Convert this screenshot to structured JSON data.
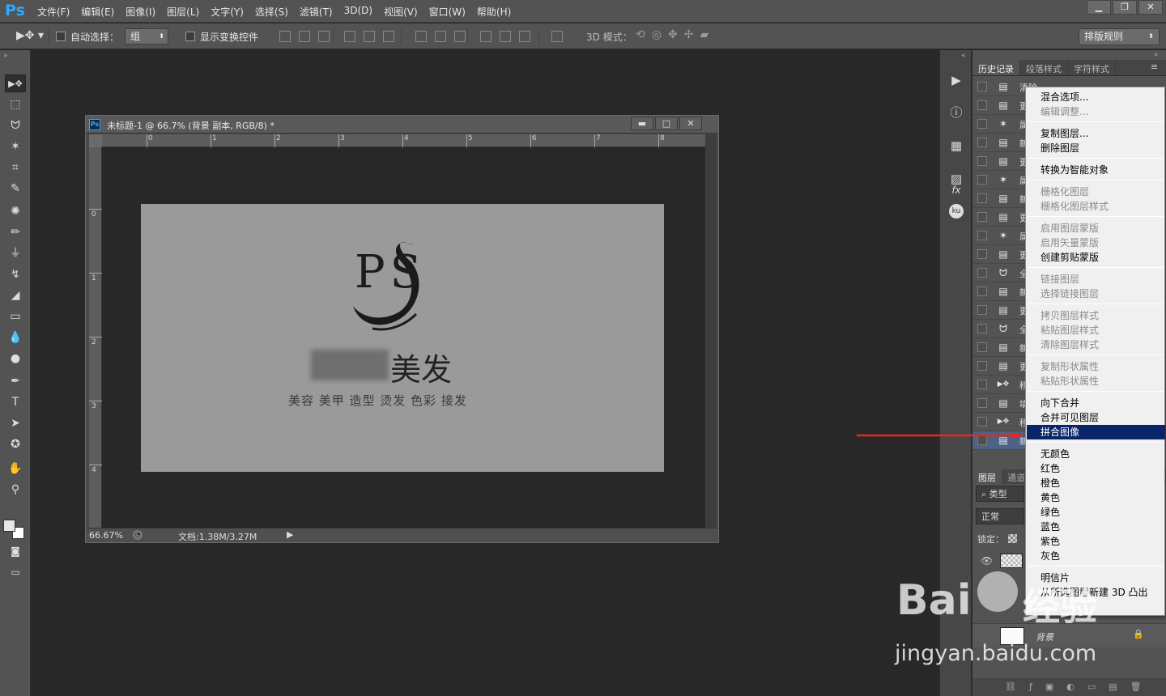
{
  "app": {
    "logo": "Ps"
  },
  "menubar": {
    "items": [
      "文件(F)",
      "编辑(E)",
      "图像(I)",
      "图层(L)",
      "文字(Y)",
      "选择(S)",
      "滤镜(T)",
      "3D(D)",
      "视图(V)",
      "窗口(W)",
      "帮助(H)"
    ],
    "window_buttons": [
      "minimize-icon",
      "restore-icon",
      "close-icon"
    ]
  },
  "options": {
    "auto_select_label": "自动选择：",
    "auto_select_value": "组",
    "show_transform_label": "显示变换控件",
    "mode_3d_label": "3D 模式：",
    "workspace_value": "排版规则"
  },
  "tools": [
    "move-tool-icon",
    "marquee-tool-icon",
    "lasso-tool-icon",
    "magic-wand-icon",
    "crop-tool-icon",
    "eyedropper-icon",
    "healing-brush-icon",
    "brush-icon",
    "clone-stamp-icon",
    "history-brush-icon",
    "eraser-icon",
    "gradient-icon",
    "blur-icon",
    "dodge-icon",
    "pen-icon",
    "type-tool-icon",
    "path-select-icon",
    "shape-tool-icon",
    "hand-tool-icon",
    "zoom-tool-icon"
  ],
  "document": {
    "title": "未标题-1 @ 66.7% (背景 副本, RGB/8) *",
    "zoom": "66.67%",
    "doc_size": "文档:1.38M/3.27M",
    "ruler_h": [
      "0",
      "1",
      "2",
      "3",
      "4",
      "5",
      "6",
      "7",
      "8"
    ],
    "ruler_v": [
      "0",
      "1",
      "2",
      "3",
      "4"
    ]
  },
  "artwork": {
    "logo_letters": "PS",
    "brand_suffix": "美发",
    "tagline": "美容 美甲 造型 烫发 色彩 接发"
  },
  "panels": {
    "tabs": [
      "历史记录",
      "段落样式",
      "字符样式"
    ],
    "history_first_label": "清除",
    "history_icons": [
      "doc",
      "doc",
      "wand",
      "doc",
      "doc",
      "wand",
      "doc",
      "doc",
      "wand",
      "doc",
      "lasso",
      "doc",
      "doc",
      "lasso",
      "doc",
      "doc",
      "move",
      "doc",
      "move",
      "doc"
    ],
    "history_labels": [
      "清除",
      "更",
      "属",
      "新",
      "更",
      "属",
      "新",
      "更",
      "属",
      "更",
      "全",
      "新",
      "更",
      "全",
      "新",
      "更",
      "移",
      "填",
      "移",
      "新"
    ],
    "layers_tabs": [
      "图层",
      "通道"
    ],
    "filter_kind": "类型",
    "blend_mode": "正常",
    "lock_label": "锁定：",
    "background_layer": "背景"
  },
  "context_menu": {
    "groups": [
      [
        {
          "label": "混合选项...",
          "enabled": true
        },
        {
          "label": "编辑调整...",
          "enabled": false
        }
      ],
      [
        {
          "label": "复制图层...",
          "enabled": true
        },
        {
          "label": "删除图层",
          "enabled": true
        }
      ],
      [
        {
          "label": "转换为智能对象",
          "enabled": true
        }
      ],
      [
        {
          "label": "栅格化图层",
          "enabled": false
        },
        {
          "label": "栅格化图层样式",
          "enabled": false
        }
      ],
      [
        {
          "label": "启用图层蒙版",
          "enabled": false
        },
        {
          "label": "启用矢量蒙版",
          "enabled": false
        },
        {
          "label": "创建剪贴蒙版",
          "enabled": true
        }
      ],
      [
        {
          "label": "链接图层",
          "enabled": false
        },
        {
          "label": "选择链接图层",
          "enabled": false
        }
      ],
      [
        {
          "label": "拷贝图层样式",
          "enabled": false
        },
        {
          "label": "粘贴图层样式",
          "enabled": false
        },
        {
          "label": "清除图层样式",
          "enabled": false
        }
      ],
      [
        {
          "label": "复制形状属性",
          "enabled": false
        },
        {
          "label": "粘贴形状属性",
          "enabled": false
        }
      ],
      [
        {
          "label": "向下合并",
          "enabled": true
        },
        {
          "label": "合并可见图层",
          "enabled": true
        },
        {
          "label": "拼合图像",
          "enabled": true,
          "highlighted": true
        }
      ],
      [
        {
          "label": "无颜色",
          "enabled": true
        },
        {
          "label": "红色",
          "enabled": true
        },
        {
          "label": "橙色",
          "enabled": true
        },
        {
          "label": "黄色",
          "enabled": true
        },
        {
          "label": "绿色",
          "enabled": true
        },
        {
          "label": "蓝色",
          "enabled": true
        },
        {
          "label": "紫色",
          "enabled": true
        },
        {
          "label": "灰色",
          "enabled": true
        }
      ],
      [
        {
          "label": "明信片",
          "enabled": true
        },
        {
          "label": "从所选图层新建 3D 凸出",
          "enabled": true
        }
      ]
    ]
  },
  "watermark": {
    "brand": "Bai",
    "brand2": "经验",
    "url": "jingyan.baidu.com"
  },
  "colors": {
    "highlight": "#0a246a",
    "arrow": "#e8251f",
    "ps_blue": "#31a8ff"
  }
}
